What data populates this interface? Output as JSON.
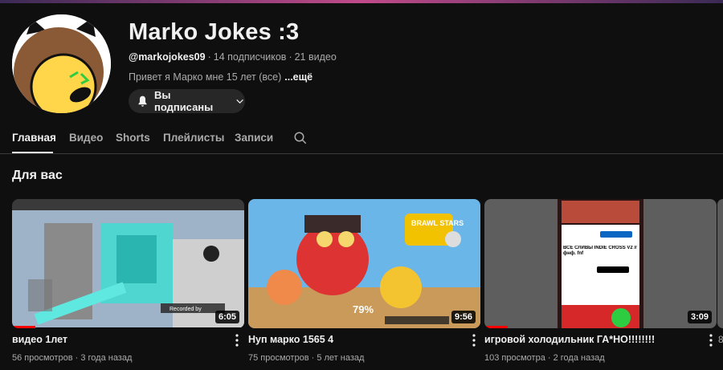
{
  "channel": {
    "title": "Marko Jokes :3",
    "handle": "@markojokes09",
    "subscribers": "14 подписчиков",
    "videos_count": "21 видео",
    "description": "Привет я Марко мне 15 лет  (все)",
    "more_label": "...ещё",
    "subscribe_label": "Вы подписаны"
  },
  "tabs": [
    {
      "label": "Главная",
      "active": true
    },
    {
      "label": "Видео"
    },
    {
      "label": "Shorts"
    },
    {
      "label": "Плейлисты"
    },
    {
      "label": "Записи"
    }
  ],
  "section": {
    "title": "Для вас"
  },
  "videos": [
    {
      "title": "видео 1лет",
      "views": "56 просмотров",
      "age": "3 года назад",
      "duration": "6:05",
      "watched_fraction": 0.1,
      "thumb_text": "Recorded by"
    },
    {
      "title": "Нуп марко 1565 4",
      "views": "75 просмотров",
      "age": "5 лет назад",
      "duration": "9:56",
      "watched_fraction": 0.0,
      "thumb_text": "BRAWL STARS",
      "thumb_percent": "79%"
    },
    {
      "title": "игровой холодильник ГА*НО!!!!!!!!",
      "views": "103 просмотра",
      "age": "2 года назад",
      "duration": "3:09",
      "watched_fraction": 0.1,
      "thumb_text": "ВСЕ СЛИВЫ INDIE CROSS V2 // фнф. fnf"
    }
  ],
  "partial_meta": "8",
  "colors": {
    "background": "#0f0f0f",
    "accent": "#ff0000"
  }
}
